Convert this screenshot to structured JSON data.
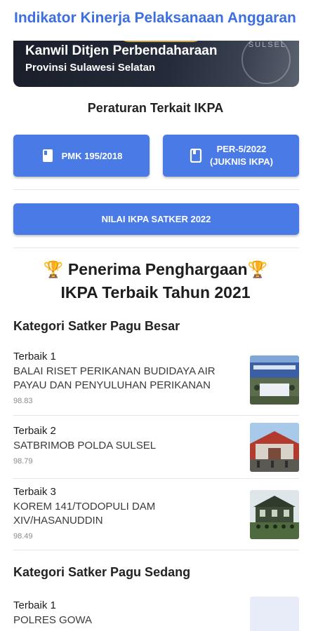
{
  "header": {
    "title": "Indikator Kinerja Pelaksanaan Anggaran"
  },
  "banner": {
    "title": "Kanwil Ditjen Perbendaharaan",
    "subtitle": "Provinsi Sulawesi Selatan",
    "seal_text": "SULSEL"
  },
  "regulations": {
    "heading": "Peraturan Terkait IKPA",
    "buttons": [
      {
        "label": "PMK 195/2018",
        "icon": "book-icon"
      },
      {
        "label_line1": "PER-5/2022",
        "label_line2": "(JUKNIS IKPA)",
        "icon": "book-open-icon"
      }
    ]
  },
  "nilai_button": {
    "label": "NILAI IKPA SATKER 2022"
  },
  "awards": {
    "title_line1": "🏆 Penerima Penghargaan🏆",
    "title_line2": "IKPA Terbaik Tahun 2021",
    "categories": [
      {
        "heading": "Kategori Satker Pagu Besar",
        "items": [
          {
            "rank": "Terbaik 1",
            "name": "BALAI RISET PERIKANAN BUDIDAYA AIR PAYAU DAN PENYULUHAN PERIKANAN",
            "score": "98.83"
          },
          {
            "rank": "Terbaik 2",
            "name": "SATBRIMOB POLDA SULSEL",
            "score": "98.79"
          },
          {
            "rank": "Terbaik 3",
            "name": "KOREM 141/TODOPULI DAM XIV/HASANUDDIN",
            "score": "98.49"
          }
        ]
      },
      {
        "heading": "Kategori Satker Pagu Sedang",
        "items": [
          {
            "rank": "Terbaik 1",
            "name": "POLRES GOWA"
          }
        ]
      }
    ]
  },
  "colors": {
    "accent": "#4a7ae5",
    "title": "#3d6fe0"
  }
}
